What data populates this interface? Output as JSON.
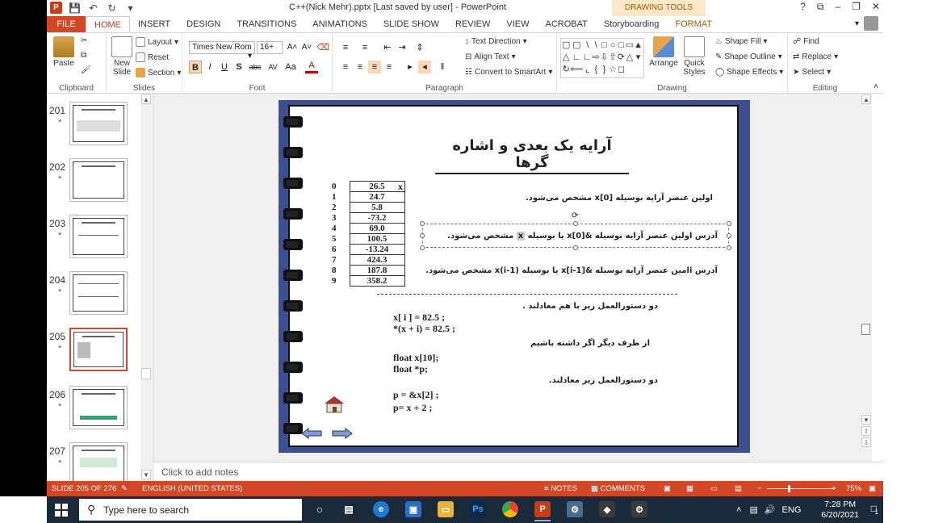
{
  "window": {
    "title": "C++(Nick Mehr).pptx [Last saved by user] - PowerPoint",
    "contextual_tab": "DRAWING TOOLS",
    "controls": [
      "?",
      "⧉",
      "–",
      "❐",
      "✕"
    ]
  },
  "tabs": [
    "FILE",
    "HOME",
    "INSERT",
    "DESIGN",
    "TRANSITIONS",
    "ANIMATIONS",
    "SLIDE SHOW",
    "REVIEW",
    "VIEW",
    "ACROBAT",
    "Storyboarding",
    "FORMAT"
  ],
  "active_tab": "HOME",
  "ribbon": {
    "clipboard": {
      "label": "Clipboard",
      "paste": "Paste"
    },
    "slides": {
      "label": "Slides",
      "new_slide": "New Slide",
      "layout": "Layout",
      "reset": "Reset",
      "section": "Section"
    },
    "font": {
      "label": "Font",
      "font_name": "Times New Rom",
      "font_size": "16+",
      "bold": "B",
      "italic": "I",
      "underline": "U",
      "shadow": "S",
      "strike": "abc",
      "spacing": "AV",
      "case": "Aa",
      "color": "A"
    },
    "paragraph": {
      "label": "Paragraph",
      "text_direction": "Text Direction",
      "align_text": "Align Text",
      "convert_smartart": "Convert to SmartArt"
    },
    "drawing": {
      "label": "Drawing",
      "arrange": "Arrange",
      "quick_styles": "Quick Styles",
      "shape_fill": "Shape Fill",
      "shape_outline": "Shape Outline",
      "shape_effects": "Shape Effects"
    },
    "editing": {
      "label": "Editing",
      "find": "Find",
      "replace": "Replace",
      "select": "Select"
    }
  },
  "thumbnails": [
    {
      "num": "201",
      "star": "*"
    },
    {
      "num": "202",
      "star": "*"
    },
    {
      "num": "203",
      "star": "*"
    },
    {
      "num": "204",
      "star": "*"
    },
    {
      "num": "205",
      "star": "*"
    },
    {
      "num": "206",
      "star": "*"
    },
    {
      "num": "207",
      "star": "*"
    }
  ],
  "active_thumbnail": "205",
  "slide": {
    "title": "آرایه یک بعدی و اشاره گرها",
    "array_name": "x",
    "indices": [
      "0",
      "1",
      "2",
      "3",
      "4",
      "5",
      "6",
      "7",
      "8",
      "9"
    ],
    "values": [
      "26.5",
      "24.7",
      "5.8",
      "-73.2",
      "69.0",
      "100.5",
      "-13.24",
      "424.3",
      "187.8",
      "358.2"
    ],
    "line1": "اولین عنصر آرایه بوسیله x[0] مشخص می‌شود.",
    "line2_pre": "آدرس اولین عنصر آرایه بوسیله &x[0] یا بوسیله",
    "line2_hl": "x",
    "line2_post": "مشخص می‌شود.",
    "line3": "آدرس i‌امین عنصر آرایه بوسیله &x[i-1] یا بوسیله (x(i-1 مشخص می‌شود.",
    "equiv_note": "دو دستورالعمل زیر با هم معادلند .",
    "code1": "x[ i ] = 82.5 ;",
    "code2": "*(x + i) = 82.5 ;",
    "other_note": "از طرف دیگر اگر داشته باشیم",
    "code3": "float x[10];",
    "code4": "float *p;",
    "equiv_note2": "دو دستورالعمل زیر معادلند.",
    "code5": "p = &x[2] ;",
    "code6": "p= x + 2 ;"
  },
  "notes_placeholder": "Click to add notes",
  "status": {
    "slide_info": "SLIDE 205 OF 276",
    "language": "ENGLISH (UNITED STATES)",
    "notes": "NOTES",
    "comments": "COMMENTS",
    "zoom": "75%"
  },
  "taskbar": {
    "search_placeholder": "Type here to search",
    "lang": "ENG",
    "time": "7:28 PM",
    "date": "6/20/2021",
    "notif_count": "1"
  },
  "colors": {
    "accent": "#d24726",
    "slide_frame": "#3d4f8f",
    "taskbar": "#1b2a3a"
  }
}
